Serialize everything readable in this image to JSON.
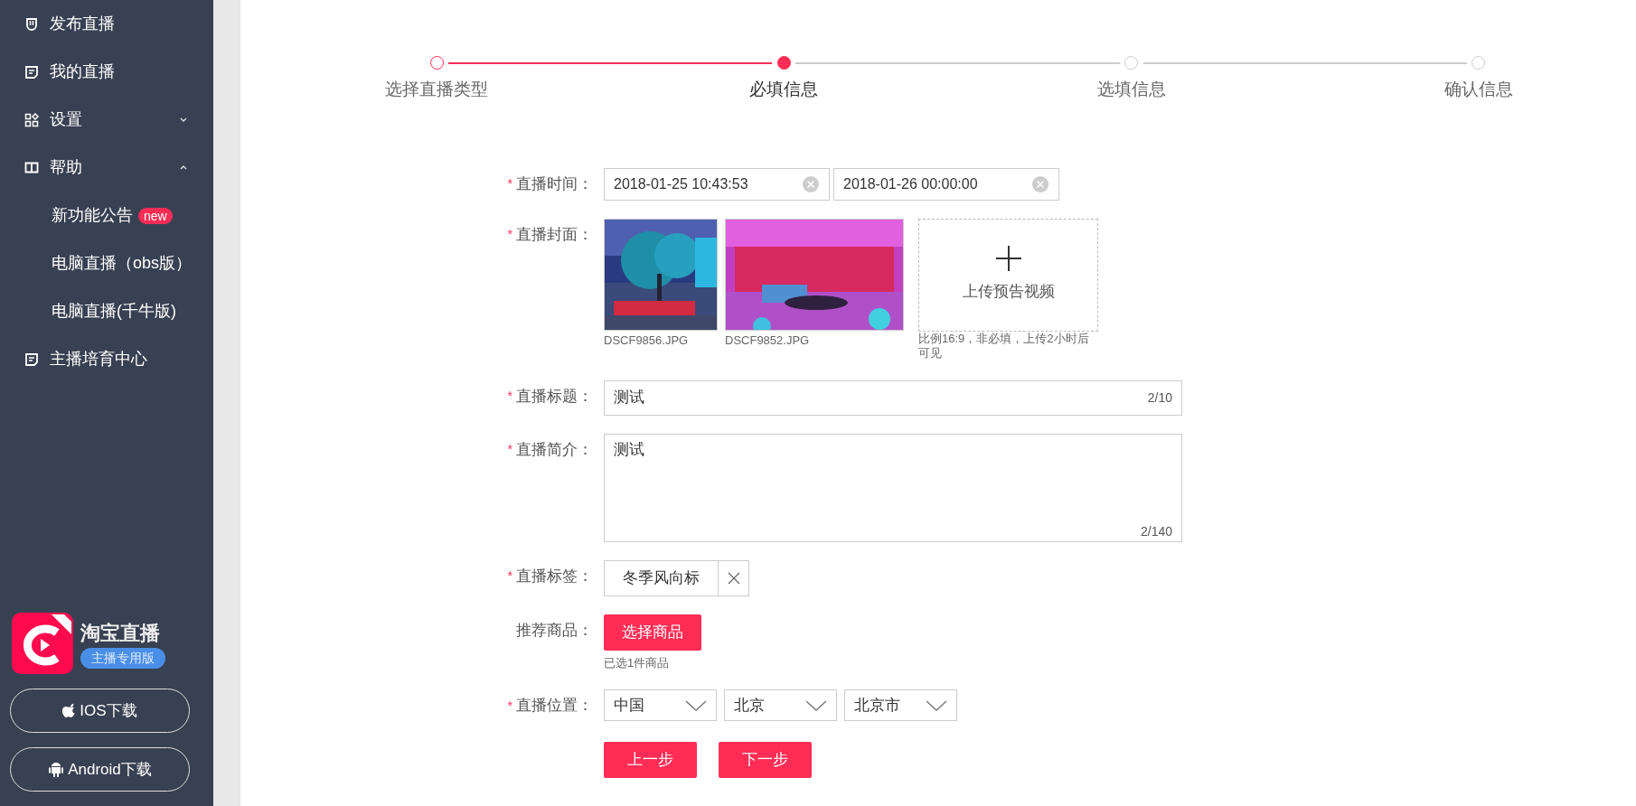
{
  "sidebar": {
    "items": [
      {
        "label": "发布直播",
        "kind": "pin"
      },
      {
        "label": "我的直播",
        "kind": "doc"
      },
      {
        "label": "设置",
        "kind": "grid",
        "expanded": false
      },
      {
        "label": "帮助",
        "kind": "book",
        "expanded": true,
        "children": [
          {
            "label": "新功能公告",
            "badge": "new"
          },
          {
            "label": "电脑直播（obs版）"
          },
          {
            "label": "电脑直播(千牛版)"
          }
        ]
      },
      {
        "label": "主播培育中心",
        "kind": "doc"
      }
    ],
    "app": {
      "name": "淘宝直播",
      "tag": "主播专用版"
    },
    "downloads": [
      {
        "label": "IOS下载",
        "kind": "apple"
      },
      {
        "label": "Android下载",
        "kind": "android"
      }
    ]
  },
  "steps": [
    {
      "label": "选择直播类型",
      "done": true,
      "selected": false
    },
    {
      "label": "必填信息",
      "done": false,
      "selected": true
    },
    {
      "label": "选填信息",
      "done": false,
      "selected": false
    },
    {
      "label": "确认信息",
      "done": false,
      "selected": false
    }
  ],
  "form": {
    "time": {
      "label": "直播时间：",
      "marker": "*",
      "start": "2018-01-25 10:43:53",
      "end": "2018-01-26 00:00:00"
    },
    "cover": {
      "label": "直播封面：",
      "marker": "*",
      "images": [
        {
          "kind": "picture",
          "caption": "DSCF9856.JPG"
        },
        {
          "kind": "picture",
          "caption": "DSCF9852.JPG"
        }
      ],
      "upload": {
        "label": "上传预告视频",
        "hint": "比例16:9，非必填，上传2小时后可见"
      }
    },
    "title": {
      "label": "直播标题：",
      "marker": "*",
      "value": "测试",
      "counter": "2/10"
    },
    "intro": {
      "label": "直播简介：",
      "marker": "*",
      "value": "测试",
      "counter": "2/140"
    },
    "tags": {
      "label": "直播标签：",
      "marker": "*",
      "items": [
        "冬季风向标"
      ]
    },
    "goods": {
      "label": "推荐商品：",
      "button": "选择商品",
      "note": "已选1件商品"
    },
    "location": {
      "label": "直播位置：",
      "marker": "*",
      "values": [
        "中国",
        "北京",
        "北京市"
      ]
    },
    "buttons": [
      "上一步",
      "下一步"
    ]
  }
}
